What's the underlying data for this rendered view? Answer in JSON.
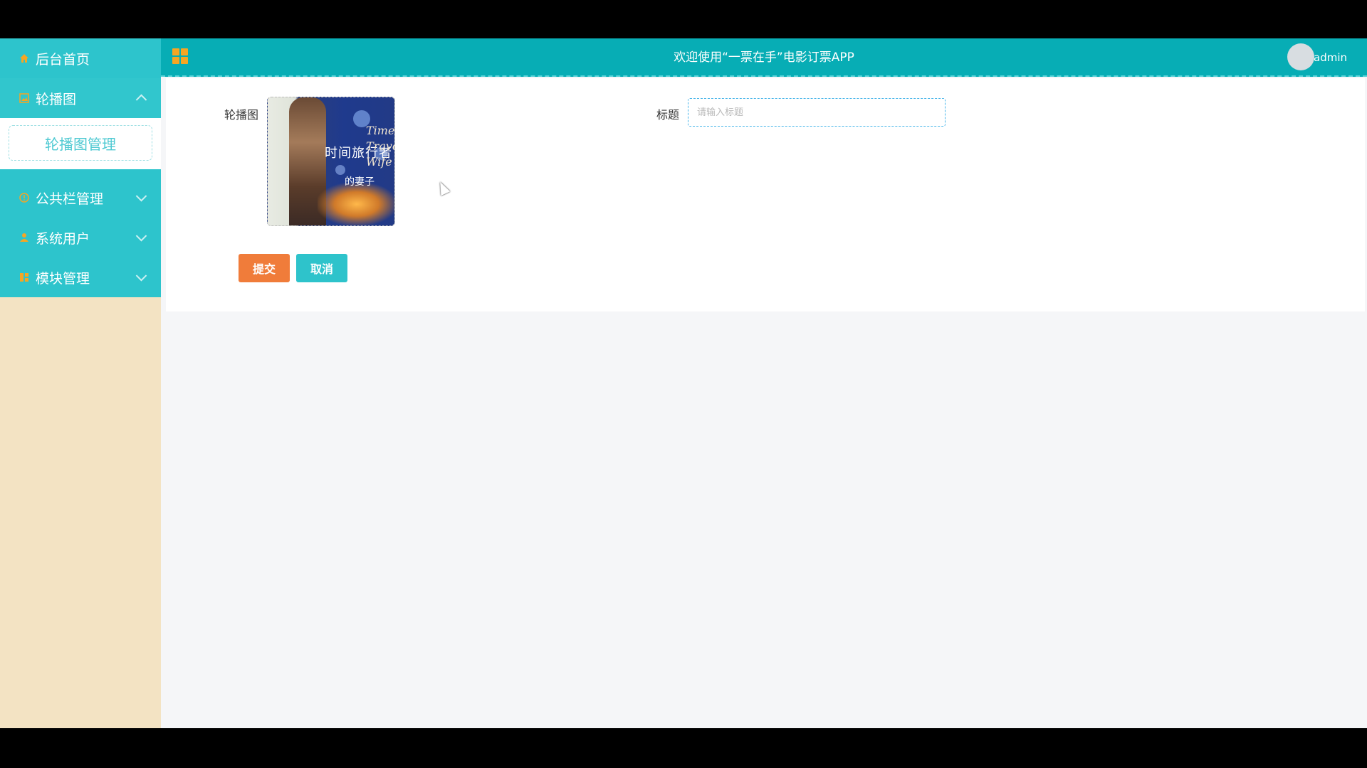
{
  "sidebar": {
    "items": [
      {
        "label": "后台首页",
        "icon": "home-icon"
      },
      {
        "label": "轮播图",
        "icon": "image-icon",
        "expanded": true
      },
      {
        "label": "公共栏管理",
        "icon": "info-icon"
      },
      {
        "label": "系统用户",
        "icon": "user-icon"
      },
      {
        "label": "模块管理",
        "icon": "modules-icon"
      }
    ],
    "submenu": {
      "label": "轮播图管理"
    }
  },
  "header": {
    "welcome": "欢迎使用“一票在手”电影订票APP",
    "username": "admin"
  },
  "form": {
    "banner_label": "轮播图",
    "banner_image": {
      "cn_title": "时间旅行者",
      "cn_sub": "的妻子",
      "en_title": "Time Traveler's Wife"
    },
    "title_label": "标题",
    "title_value": "",
    "title_placeholder": "请输入标题",
    "submit_label": "提交",
    "cancel_label": "取消"
  },
  "colors": {
    "sidebar_teal": "#2dc4cc",
    "topbar": "#07adb5",
    "submit": "#f07c3a",
    "cancel": "#2ec3cb",
    "sidebar_bg": "#f3e3c3",
    "icon_accent": "#f6a623"
  }
}
